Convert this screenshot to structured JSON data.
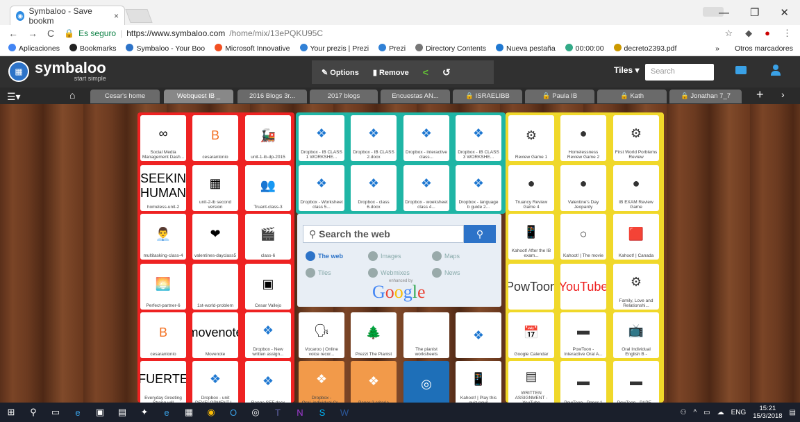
{
  "browser": {
    "tab_title": "Symbaloo - Save bookm",
    "tab_close": "×",
    "nav": {
      "back": "←",
      "forward": "→",
      "reload": "C"
    },
    "secure_label": "Es seguro",
    "url_main": "https://www.symbaloo.com",
    "url_path": "/home/mix/13ePQKU95C",
    "window_controls": {
      "min": "—",
      "max": "❐",
      "close": "✕"
    },
    "bookmarks": [
      {
        "label": "Aplicaciones",
        "color": "#4285f4"
      },
      {
        "label": "Bookmarks",
        "color": "#222"
      },
      {
        "label": "Symbaloo - Your Boo",
        "color": "#2d73c8"
      },
      {
        "label": "Microsoft Innovative",
        "color": "#f25022"
      },
      {
        "label": "Your prezis | Prezi",
        "color": "#3181d6"
      },
      {
        "label": "Prezi",
        "color": "#3181d6"
      },
      {
        "label": "Directory Contents",
        "color": "#777"
      },
      {
        "label": "Nueva pestaña",
        "color": "#1f78d1"
      },
      {
        "label": "00:00:00",
        "color": "#3a8"
      },
      {
        "label": "decreto2393.pdf",
        "color": "#c90"
      }
    ],
    "bookmarks_more": "»",
    "other_bookmarks": "Otros marcadores"
  },
  "symbaloo": {
    "logo_name": "symbaloo",
    "logo_sub": "start simple",
    "options": "Options",
    "remove": "Remove",
    "tiles": "Tiles ▾",
    "search_placeholder": "Search",
    "webmix_tabs": [
      {
        "label": "Cesar's home",
        "active": false
      },
      {
        "label": "Webquest IB _",
        "active": true
      },
      {
        "label": "2016 Blogs 3r...",
        "active": false
      },
      {
        "label": "2017 blogs",
        "active": false
      },
      {
        "label": "Encuestas AN...",
        "active": false
      },
      {
        "label": "🔒 ISRAELIBB",
        "active": false
      },
      {
        "label": "🔒 Paula IB",
        "active": false
      },
      {
        "label": "🔒 Kath",
        "active": false
      },
      {
        "label": "🔒 Jonathan 7_7",
        "active": false
      }
    ]
  },
  "red_tiles": [
    [
      "Social Media Management Dash...",
      "cesarantonio",
      "unit-1-ib-dp-2015"
    ],
    [
      "homeless-unit-2",
      "unit-2-ib second version",
      "Truant-class-3"
    ],
    [
      "multitasking-class-4",
      "valentines-dayclass5",
      "class-6"
    ],
    [
      "Perfect-partner-6",
      "1st-world-problem",
      "Cesar Vallejo"
    ],
    [
      "cesarantonio",
      "Movenote",
      "Dropbox - New written assign..."
    ],
    [
      "Everyday Greeting Strong will",
      "Dropbox - unit DEVELOPMENT I...",
      "Range SEF.docx"
    ]
  ],
  "red_tile_images": [
    "∞",
    "B",
    "🚂",
    "SEEKIN HUMAN",
    "▦",
    "👥",
    "👨‍💼",
    "❤",
    "🎬",
    "🌅",
    "",
    "▣",
    "B",
    "movenote",
    "⬡",
    "FUERTE",
    "⬡",
    "⬡"
  ],
  "teal_tiles": [
    [
      "Dropbox - IB CLASS 1 WORKSHE...",
      "Dropbox - IB CLASS 2.docx",
      "Dropbox - interactive class...",
      "Dropbox - IB CLASS 3 WORKSHE..."
    ],
    [
      "Dropbox - Worksheet class 5...",
      "Dropbox - class 6.docx",
      "Dropbox - woeksheet class 4...",
      "Dropbox - language b guide 2..."
    ]
  ],
  "yellow_tiles": [
    [
      "Review Game 1",
      "Homelessness Review Game 2",
      "First World Porblems Review"
    ],
    [
      "Truancy Review Game 4",
      "Valentine's Day Jeopardy",
      "IB EXAM Review Game"
    ],
    [
      "Kahoot! After the IB exam...",
      "Kahoot! | The movie",
      "Kahoot! | Canada"
    ],
    [
      "",
      "",
      "Family, Love and Relationshi..."
    ],
    [
      "Google Calendar",
      "PowToon - Interactive Oral A...",
      "Oral Individual English B -"
    ],
    [
      "WRITTEN ASSIGNMENT - YouTube",
      "PowToon - Paper 1",
      "PowToon - PAPE..."
    ]
  ],
  "yellow_tile_images": [
    "⚙",
    "●",
    "⚙",
    "●",
    "●",
    "●",
    "📱",
    "○",
    "🟥",
    "PowToon",
    "YouTube",
    "⚙",
    "📅",
    "▬",
    "📺",
    "▤",
    "▬",
    "▬"
  ],
  "bottom_tiles": [
    {
      "label": "Vocaroo | Online voice recor...",
      "bg": "#fff"
    },
    {
      "label": "Prezzi The Pianist",
      "bg": "#fff"
    },
    {
      "label": "The pianist worksheets",
      "bg": "#fff"
    },
    {
      "label": "",
      "bg": "#fff"
    },
    {
      "label": "Dropbox - Oral_individual Cr...",
      "bg": "#f29a4a"
    },
    {
      "label": "Paper 2 criteria",
      "bg": "#f29a4a"
    },
    {
      "label": "",
      "bg": "#1e6fb8"
    },
    {
      "label": "Kahoot! | Play this quiz now!",
      "bg": "#fff"
    }
  ],
  "search_web": {
    "placeholder": "Search the web",
    "options": [
      "The web",
      "Images",
      "Maps",
      "Tiles",
      "Webmixes",
      "News"
    ],
    "enhanced": "enhanced by",
    "google": "Google"
  },
  "taskbar": {
    "lang": "ENG",
    "time": "15:21",
    "date": "15/3/2018"
  }
}
